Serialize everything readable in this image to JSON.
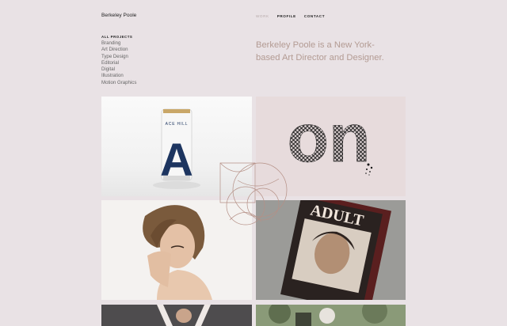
{
  "site": {
    "brand": "Berkeley Poole"
  },
  "nav": {
    "items": [
      "WORK",
      "PROFILE",
      "CONTACT"
    ]
  },
  "categories": {
    "heading": "ALL PROJECTS",
    "items": [
      "Branding",
      "Art Direction",
      "Type Design",
      "Editorial",
      "Digital",
      "Illustration",
      "Motion Graphics"
    ]
  },
  "intro": "Berkeley Poole is a New York-based Art Director and Designer.",
  "tiles": [
    {
      "can_brand": "ACE HILL",
      "can_letter": "A"
    },
    {
      "word": "on"
    },
    {},
    {
      "magazine_title": "ADULT"
    }
  ],
  "colors": {
    "background": "#e9e2e5",
    "intro_text": "#b39b93",
    "nav_active": "#b7aaa9"
  }
}
